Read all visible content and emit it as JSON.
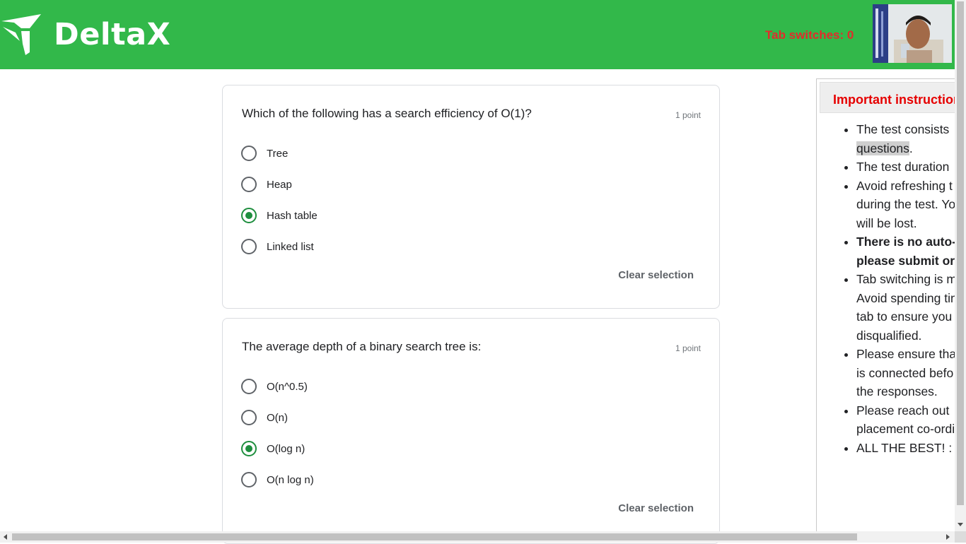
{
  "header": {
    "brand": "DeltaX",
    "tab_switches": "Tab switches: 0",
    "bg_color": "#32b84a"
  },
  "questions": [
    {
      "text": "Which of the following has a search efficiency of O(1)?",
      "points": "1 point",
      "options": [
        "Tree",
        "Heap",
        "Hash table",
        "Linked list"
      ],
      "selected": "Hash table",
      "clear_label": "Clear selection"
    },
    {
      "text": "The average depth of a binary search tree is:",
      "points": "1 point",
      "options": [
        "O(n^0.5)",
        "O(n)",
        "O(log n)",
        "O(n log n)"
      ],
      "selected": "O(log n)",
      "clear_label": "Clear selection"
    }
  ],
  "instructions": {
    "title": "Important instruction",
    "lines": [
      "The test consists",
      "questions",
      ".",
      "The test duration",
      "Avoid refreshing t",
      "during the test. Yo",
      "will be lost.",
      "There is no auto-",
      "please submit or",
      "Tab switching is m",
      "Avoid spending tin",
      "tab to ensure you",
      "disqualified.",
      "Please ensure tha",
      "is connected befo",
      "the responses.",
      "Please reach out",
      "placement co-ordi",
      "ALL THE BEST! :"
    ]
  },
  "icons": {
    "logo": "deltax-logo-icon",
    "webcam": "webcam-preview"
  }
}
